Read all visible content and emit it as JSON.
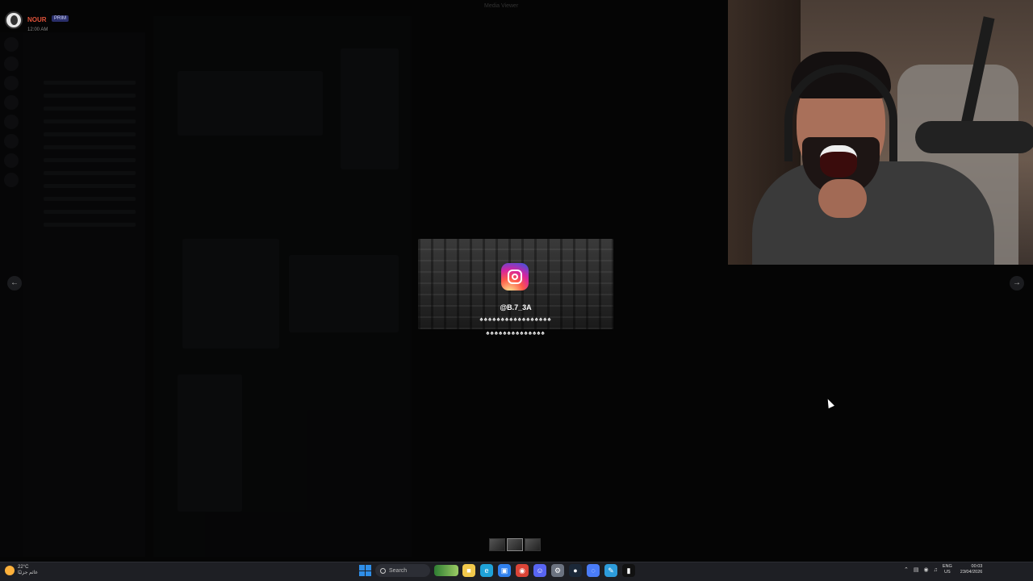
{
  "user": {
    "name": "NOUR",
    "tag": "PRIM",
    "time": "12:00 AM"
  },
  "lightbox": {
    "title": "Media Viewer",
    "handle": "@B.7_3A",
    "caption_line_1": "♠♠♠♠♠♠♠♠♠♠♠♠♠♠♠♠♠",
    "caption_line_2": "♠♠♠♠♠♠♠♠♠♠♠♠♠♠"
  },
  "navigation": {
    "prev_glyph": "←",
    "next_glyph": "→"
  },
  "taskbar": {
    "weather_temp": "22°C",
    "weather_desc": "غائم جزئيًا",
    "search_label": "Search",
    "apps": [
      {
        "name": "file-explorer",
        "glyph": "■",
        "color": "#f2c94c"
      },
      {
        "name": "edge",
        "glyph": "e",
        "color": "#1fa2d8"
      },
      {
        "name": "store",
        "glyph": "▣",
        "color": "#2f80ed"
      },
      {
        "name": "chrome",
        "glyph": "◉",
        "color": "#db4437"
      },
      {
        "name": "discord",
        "glyph": "☺",
        "color": "#5865f2"
      },
      {
        "name": "settings",
        "glyph": "⚙",
        "color": "#6c7380"
      },
      {
        "name": "steam",
        "glyph": "●",
        "color": "#1b2838"
      },
      {
        "name": "messenger",
        "glyph": "◌",
        "color": "#4a7cf7"
      },
      {
        "name": "paint",
        "glyph": "✎",
        "color": "#2d9cdb"
      },
      {
        "name": "terminal",
        "glyph": "▮",
        "color": "#111111"
      }
    ],
    "tray_arrow": "⌃",
    "lang_line_1": "ENG",
    "lang_line_2": "US",
    "clock_time": "00:03",
    "clock_date": "23/04/2026"
  }
}
